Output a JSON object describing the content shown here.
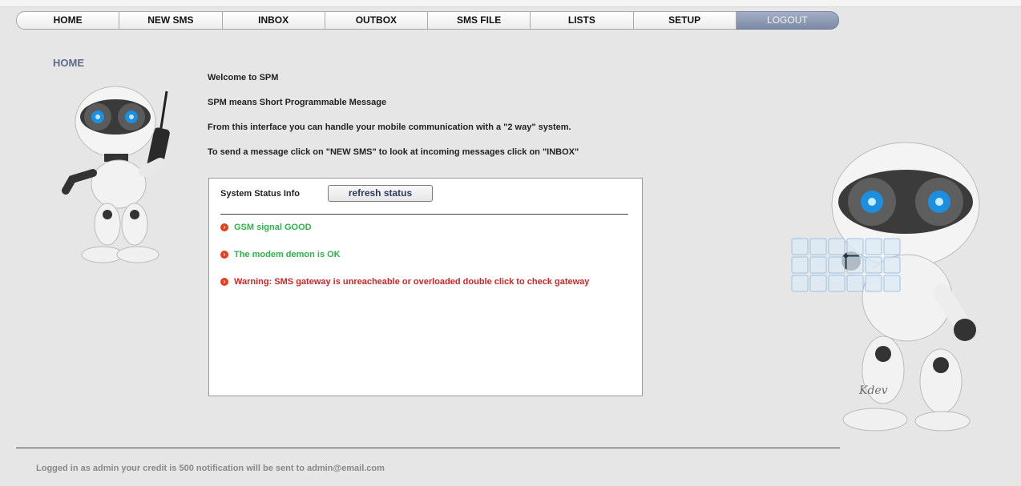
{
  "nav": {
    "items": [
      {
        "label": "HOME"
      },
      {
        "label": "NEW SMS"
      },
      {
        "label": "INBOX"
      },
      {
        "label": "OUTBOX"
      },
      {
        "label": "SMS FILE"
      },
      {
        "label": "LISTS"
      },
      {
        "label": "SETUP"
      },
      {
        "label": "LOGOUT"
      }
    ]
  },
  "page": {
    "title": "HOME"
  },
  "welcome": {
    "line1": "Welcome to SPM",
    "line2": "SPM means Short Programmable Message",
    "line3": "From this interface you can handle your mobile communication with a \"2 way\" system.",
    "line4": "To send a message click on \"NEW SMS\" to look at incoming messages click on \"INBOX\""
  },
  "status_panel": {
    "label": "System Status Info",
    "refresh_label": "refresh status",
    "items": [
      {
        "text": "GSM signal GOOD",
        "level": "ok"
      },
      {
        "text": "The modem demon is OK",
        "level": "ok"
      },
      {
        "text": "Warning: SMS gateway is unreacheable or overloaded double click to check gateway",
        "level": "warning"
      }
    ]
  },
  "footer": {
    "text": "Logged in as admin your credit is 500 notification will be sent to admin@email.com"
  },
  "robot_brand": "Kdev",
  "colors": {
    "ok": "#2db34a",
    "warning": "#d22525",
    "accent": "#5f6a87",
    "bullet": "#e4411c"
  }
}
